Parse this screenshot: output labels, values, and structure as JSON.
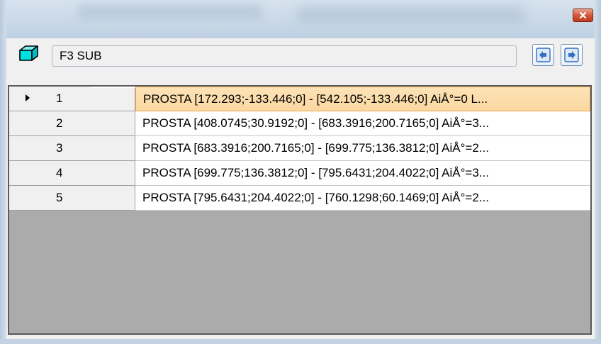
{
  "window": {
    "close_icon": "close-icon"
  },
  "toolbar": {
    "object_icon": "cube-icon",
    "name_value": "F3 SUB",
    "prev_icon": "arrow-left-icon",
    "next_icon": "arrow-right-icon",
    "accent": "#2f6fc5"
  },
  "grid": {
    "selected_row_index": 0,
    "selected_color": "#fbd9a4",
    "rows": [
      {
        "num": "1",
        "text": "PROSTA [172.293;-133.446;0] - [542.105;-133.446;0] AiÅ°=0 L..."
      },
      {
        "num": "2",
        "text": "PROSTA [408.0745;30.9192;0] - [683.3916;200.7165;0] AiÅ°=3..."
      },
      {
        "num": "3",
        "text": "PROSTA [683.3916;200.7165;0] - [699.775;136.3812;0] AiÅ°=2..."
      },
      {
        "num": "4",
        "text": "PROSTA [699.775;136.3812;0] - [795.6431;204.4022;0] AiÅ°=3..."
      },
      {
        "num": "5",
        "text": "PROSTA [795.6431;204.4022;0] - [760.1298;60.1469;0] AiÅ°=2..."
      }
    ]
  }
}
